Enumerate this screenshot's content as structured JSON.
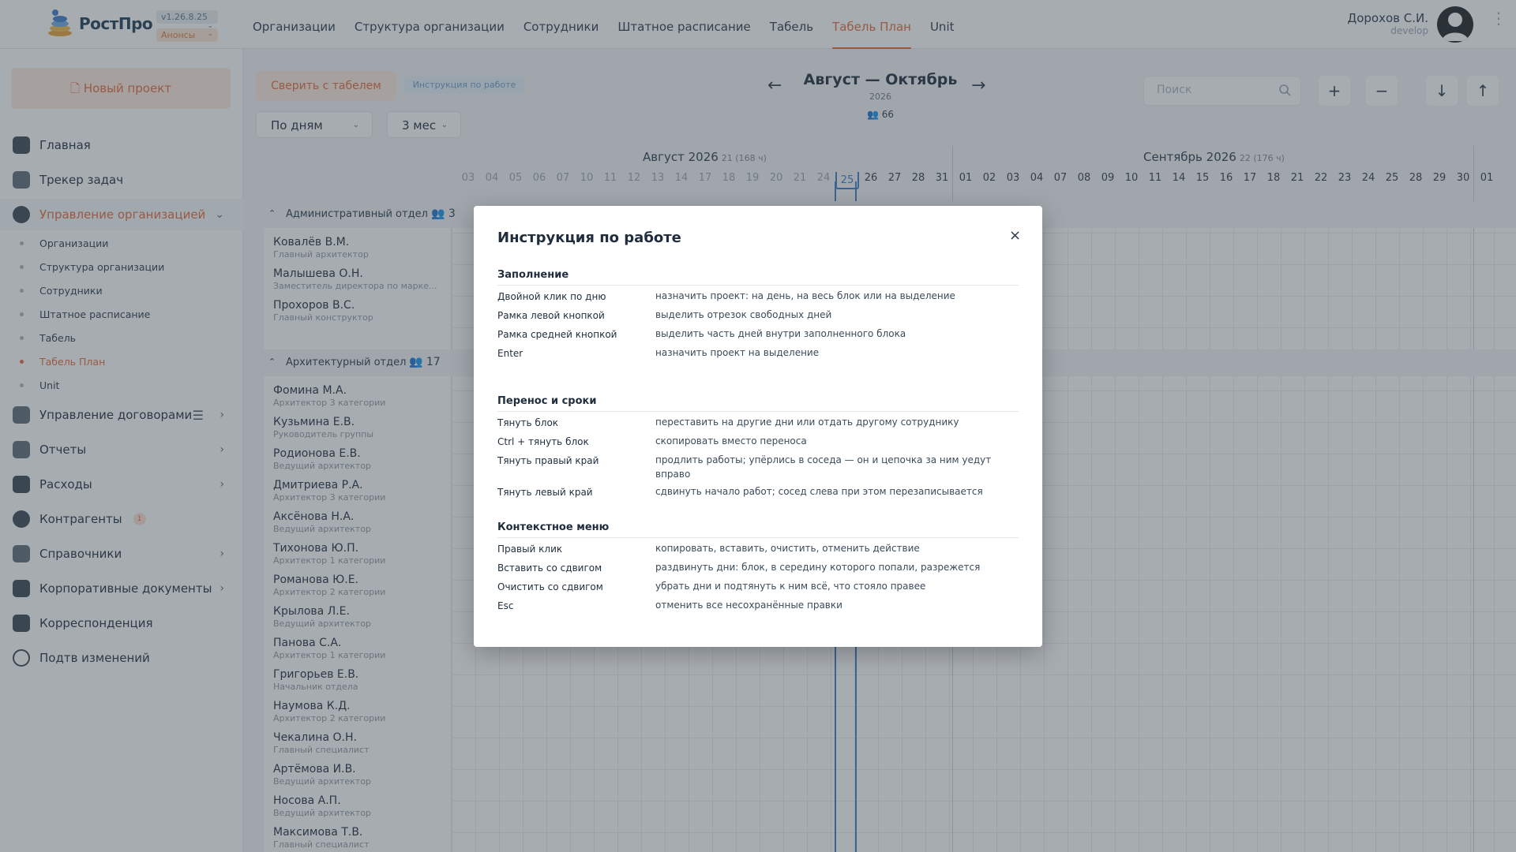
{
  "header": {
    "brand": "РостПро",
    "version": "v1.26.8.25",
    "announcements": "Анонсы",
    "nav": [
      {
        "label": "Организации"
      },
      {
        "label": "Структура организации"
      },
      {
        "label": "Сотрудники"
      },
      {
        "label": "Штатное расписание"
      },
      {
        "label": "Табель"
      },
      {
        "label": "Табель План",
        "active": true
      },
      {
        "label": "Unit"
      }
    ],
    "user": {
      "name": "Дорохов С.И.",
      "role": "develop"
    }
  },
  "sidebar": {
    "new_project": "Новый проект",
    "items": [
      {
        "label": "Главная",
        "icon": "dashboard-icon"
      },
      {
        "label": "Трекер задач",
        "icon": "tasks-icon"
      },
      {
        "label": "Управление организацией",
        "icon": "people-icon",
        "active": true
      },
      {
        "label": "Управление договорами",
        "icon": "contracts-icon"
      },
      {
        "label": "Отчеты",
        "icon": "reports-icon"
      },
      {
        "label": "Расходы",
        "icon": "money-icon"
      },
      {
        "label": "Контрагенты",
        "icon": "partners-icon",
        "badge": "1"
      },
      {
        "label": "Справочники",
        "icon": "book-icon"
      },
      {
        "label": "Корпоративные документы",
        "icon": "folder-icon"
      },
      {
        "label": "Корреспонденция",
        "icon": "mail-icon"
      },
      {
        "label": "Подтв изменений",
        "icon": "info-icon"
      }
    ],
    "sub_items": [
      {
        "label": "Организации"
      },
      {
        "label": "Структура организации"
      },
      {
        "label": "Сотрудники"
      },
      {
        "label": "Штатное расписание"
      },
      {
        "label": "Табель"
      },
      {
        "label": "Табель План",
        "active": true
      },
      {
        "label": "Unit"
      }
    ]
  },
  "toolbar": {
    "reconcile": "Сверить с табелем",
    "instructions": "Инструкция по работе",
    "view_mode": "По дням",
    "range": "3 мес",
    "search_placeholder": "Поиск",
    "period_title": "Август — Октябрь",
    "period_year": "2026",
    "employee_count": "66",
    "zoom_in": "+",
    "zoom_out": "−"
  },
  "timeline": {
    "months": [
      {
        "name": "Август 2026",
        "info": "21 (168 ч)"
      },
      {
        "name": "Сентябрь 2026",
        "info": "22 (176 ч)"
      }
    ],
    "august_days": [
      "03",
      "04",
      "05",
      "06",
      "07",
      "10",
      "11",
      "12",
      "13",
      "14",
      "17",
      "18",
      "19",
      "20",
      "21",
      "24",
      "25",
      "26",
      "27",
      "28",
      "31"
    ],
    "september_days": [
      "01",
      "02",
      "03",
      "04",
      "07",
      "08",
      "09",
      "10",
      "11",
      "14",
      "15",
      "16",
      "17",
      "18",
      "21",
      "22",
      "23",
      "24",
      "25",
      "28",
      "29",
      "30"
    ],
    "october_days": [
      "01"
    ],
    "today": "25"
  },
  "groups": [
    {
      "name": "Административный отдел",
      "count": "3",
      "employees": [
        {
          "name": "Ковалёв В.М.",
          "role": "Главный архитектор"
        },
        {
          "name": "Малышева О.Н.",
          "role": "Заместитель директора по марке..."
        },
        {
          "name": "Прохоров В.С.",
          "role": "Главный конструктор"
        }
      ]
    },
    {
      "name": "Архитектурный отдел",
      "count": "17",
      "employees": [
        {
          "name": "Фомина М.А.",
          "role": "Архитектор 3 категории"
        },
        {
          "name": "Кузьмина Е.В.",
          "role": "Руководитель группы"
        },
        {
          "name": "Родионова Е.В.",
          "role": "Ведущий архитектор"
        },
        {
          "name": "Дмитриева Р.А.",
          "role": "Архитектор 3 категории"
        },
        {
          "name": "Аксёнова Н.А.",
          "role": "Ведущий архитектор"
        },
        {
          "name": "Тихонова Ю.П.",
          "role": "Архитектор 1 категории"
        },
        {
          "name": "Романова Ю.Е.",
          "role": "Архитектор 2 категории"
        },
        {
          "name": "Крылова Л.Е.",
          "role": "Ведущий архитектор"
        },
        {
          "name": "Панова С.А.",
          "role": "Архитектор 1 категории"
        },
        {
          "name": "Григорьев Е.В.",
          "role": "Начальник отдела"
        },
        {
          "name": "Наумова К.Д.",
          "role": "Архитектор 2 категории"
        },
        {
          "name": "Чекалина О.Н.",
          "role": "Главный специалист"
        },
        {
          "name": "Артёмова И.В.",
          "role": "Ведущий архитектор"
        },
        {
          "name": "Носова А.П.",
          "role": "Ведущий архитектор"
        },
        {
          "name": "Максимова Т.В.",
          "role": "Главный специалист"
        }
      ]
    }
  ],
  "modal": {
    "title": "Инструкция по работе",
    "close": "×",
    "sections": [
      {
        "title": "Заполнение",
        "rows": [
          {
            "key": "Двойной клик по дню",
            "value": "назначить проект: на день, на весь блок или на выделение"
          },
          {
            "key": "Рамка левой кнопкой",
            "value": "выделить отрезок свободных дней"
          },
          {
            "key": "Рамка средней кнопкой",
            "value": "выделить часть дней внутри заполненного блока"
          },
          {
            "key": "Enter",
            "value": "назначить проект на выделение"
          }
        ]
      },
      {
        "title": "Перенос и сроки",
        "rows": [
          {
            "key": "Тянуть блок",
            "value": "переставить на другие дни или отдать другому сотруднику"
          },
          {
            "key": "Ctrl + тянуть блок",
            "value": "скопировать вместо переноса"
          },
          {
            "key": "Тянуть правый край",
            "value": "продлить работы; упёрлись в соседа — он и цепочка за ним уедут вправо"
          },
          {
            "key": "Тянуть левый край",
            "value": "сдвинуть начало работ; сосед слева при этом перезаписывается"
          }
        ]
      },
      {
        "title": "Контекстное меню",
        "rows": [
          {
            "key": "Правый клик",
            "value": "копировать, вставить, очистить, отменить действие"
          },
          {
            "key": "Вставить со сдвигом",
            "value": "раздвинуть дни: блок, в середину которого попали, разрежется"
          },
          {
            "key": "Очистить со сдвигом",
            "value": "убрать дни и подтянуть к ним всё, что стояло правее"
          },
          {
            "key": "Esc",
            "value": "отменить все несохранённые правки"
          }
        ]
      }
    ]
  }
}
